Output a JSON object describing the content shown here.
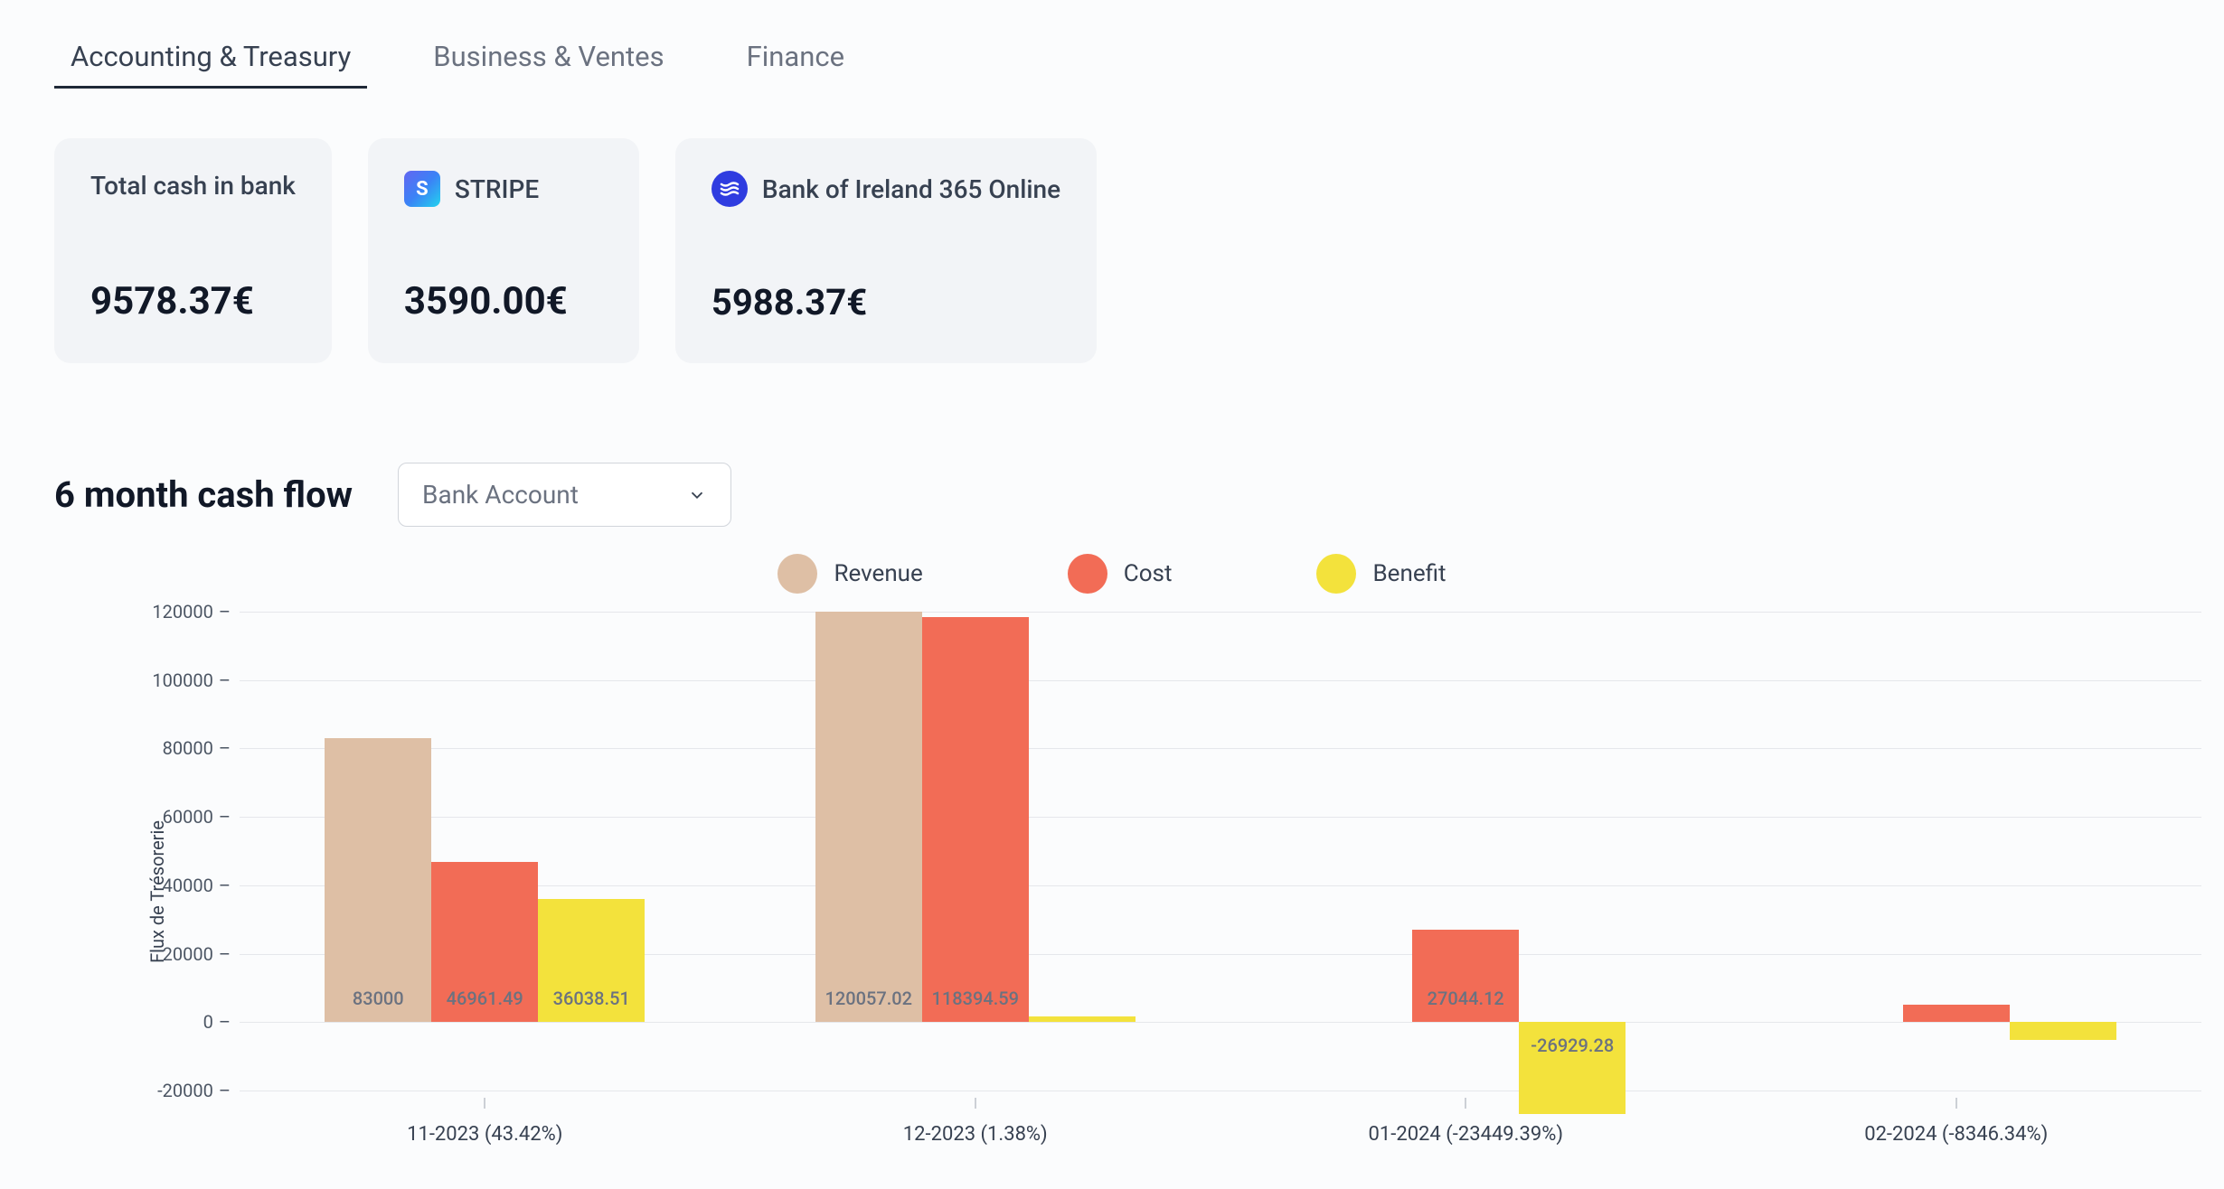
{
  "tabs": [
    {
      "label": "Accounting & Treasury",
      "active": true
    },
    {
      "label": "Business & Ventes",
      "active": false
    },
    {
      "label": "Finance",
      "active": false
    }
  ],
  "cards": {
    "total": {
      "label": "Total cash in bank",
      "value": "9578.37€"
    },
    "stripe": {
      "label": "STRIPE",
      "value": "3590.00€"
    },
    "boi": {
      "label": "Bank of Ireland 365 Online",
      "value": "5988.37€"
    }
  },
  "chart": {
    "title": "6 month cash flow",
    "dropdown": "Bank Account",
    "ylabel": "Flux de Trésorerie",
    "legend": {
      "revenue": "Revenue",
      "cost": "Cost",
      "benefit": "Benefit"
    }
  },
  "colors": {
    "revenue": "#debfa5",
    "cost": "#f26c56",
    "benefit": "#f3e23c"
  },
  "chart_data": {
    "type": "bar",
    "title": "6 month cash flow",
    "xlabel": "",
    "ylabel": "Flux de Trésorerie",
    "ylim": [
      -20000,
      120000
    ],
    "yticks": [
      -20000,
      0,
      20000,
      40000,
      60000,
      80000,
      100000,
      120000
    ],
    "categories": [
      "11-2023 (43.42%)",
      "12-2023 (1.38%)",
      "01-2024 (-23449.39%)",
      "02-2024 (-8346.34%)"
    ],
    "series": [
      {
        "name": "Revenue",
        "values": [
          83000,
          120057.02,
          0,
          0
        ]
      },
      {
        "name": "Cost",
        "values": [
          46961.49,
          118394.59,
          27044.12,
          5200
        ]
      },
      {
        "name": "Benefit",
        "values": [
          36038.51,
          1662.43,
          -26929.28,
          -5200
        ]
      }
    ],
    "data_labels": [
      [
        "83000",
        "120057.02",
        "",
        ""
      ],
      [
        "46961.49",
        "118394.59",
        "27044.12",
        ""
      ],
      [
        "36038.51",
        "",
        "-26929.28",
        ""
      ]
    ]
  }
}
